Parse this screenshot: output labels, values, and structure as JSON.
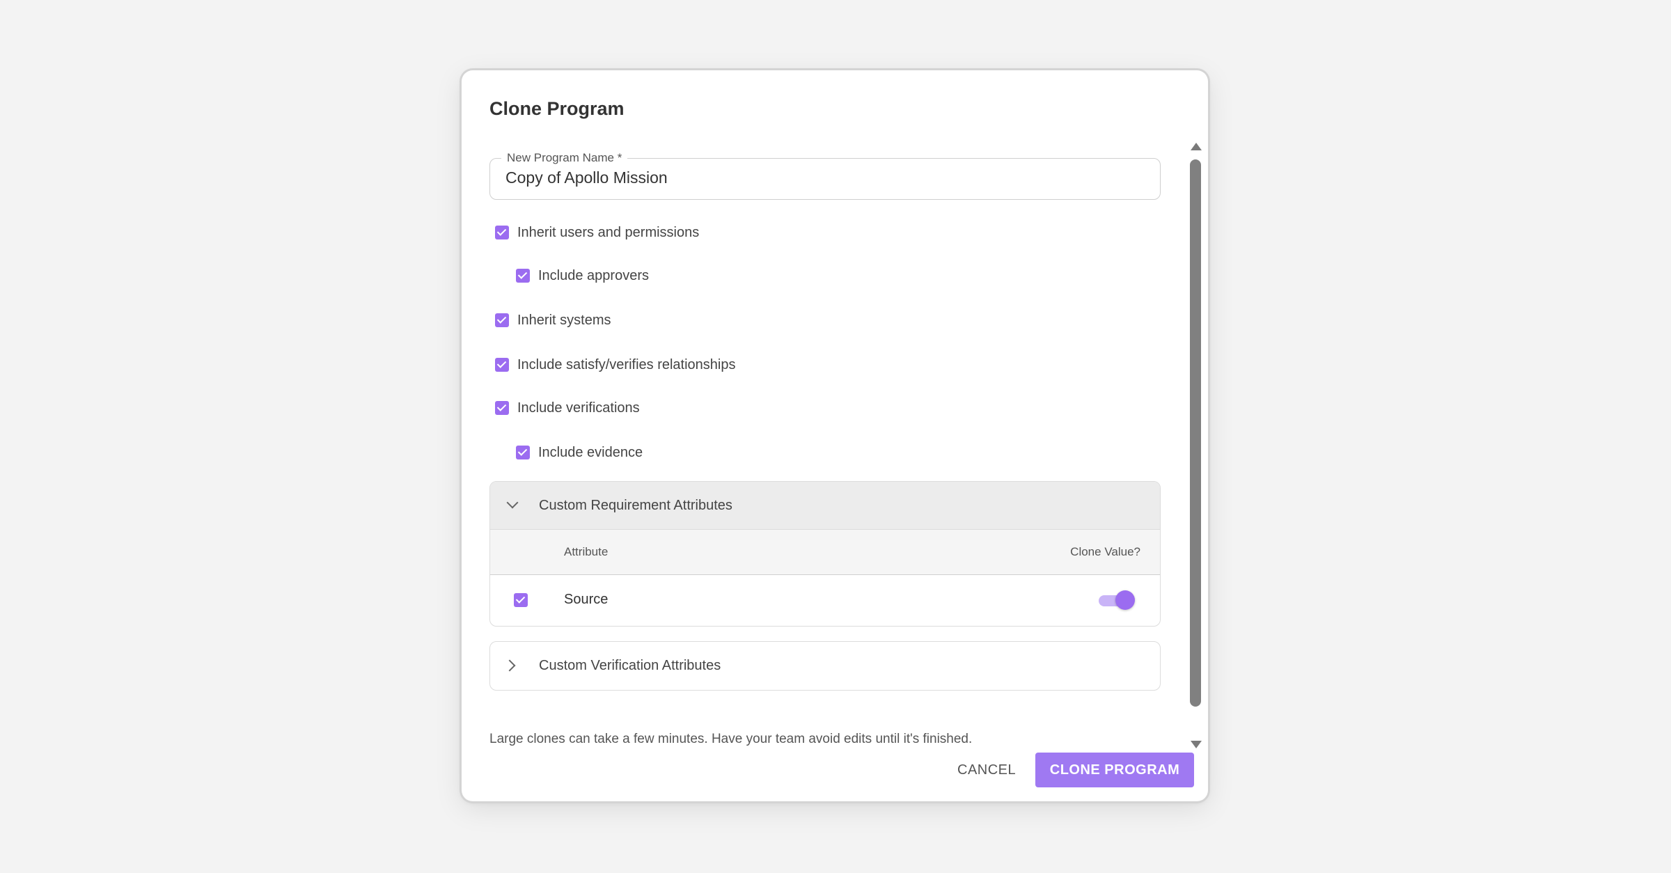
{
  "dialog": {
    "title": "Clone Program"
  },
  "name_field": {
    "label": "New Program Name *",
    "value": "Copy of Apollo Mission"
  },
  "options": [
    {
      "label": "Inherit users and permissions",
      "checked": true,
      "indent": 0
    },
    {
      "label": "Include approvers",
      "checked": true,
      "indent": 1
    },
    {
      "label": "Inherit systems",
      "checked": true,
      "indent": 0
    },
    {
      "label": "Include satisfy/verifies relationships",
      "checked": true,
      "indent": 0
    },
    {
      "label": "Include verifications",
      "checked": true,
      "indent": 0
    },
    {
      "label": "Include evidence",
      "checked": true,
      "indent": 1
    }
  ],
  "requirement_attributes": {
    "title": "Custom Requirement Attributes",
    "expanded": true,
    "columns": {
      "attribute": "Attribute",
      "clone_value": "Clone Value?"
    },
    "rows": [
      {
        "name": "Source",
        "selected": true,
        "clone_value": true
      }
    ]
  },
  "verification_attributes": {
    "title": "Custom Verification Attributes",
    "expanded": false
  },
  "footer": {
    "note": "Large clones can take a few minutes. Have your team avoid edits until it's finished.",
    "cancel_label": "CANCEL",
    "clone_label": "CLONE PROGRAM"
  },
  "colors": {
    "accent": "#9b6cf0",
    "button": "#9f79f2",
    "toggle_track": "#c9b4f7"
  }
}
